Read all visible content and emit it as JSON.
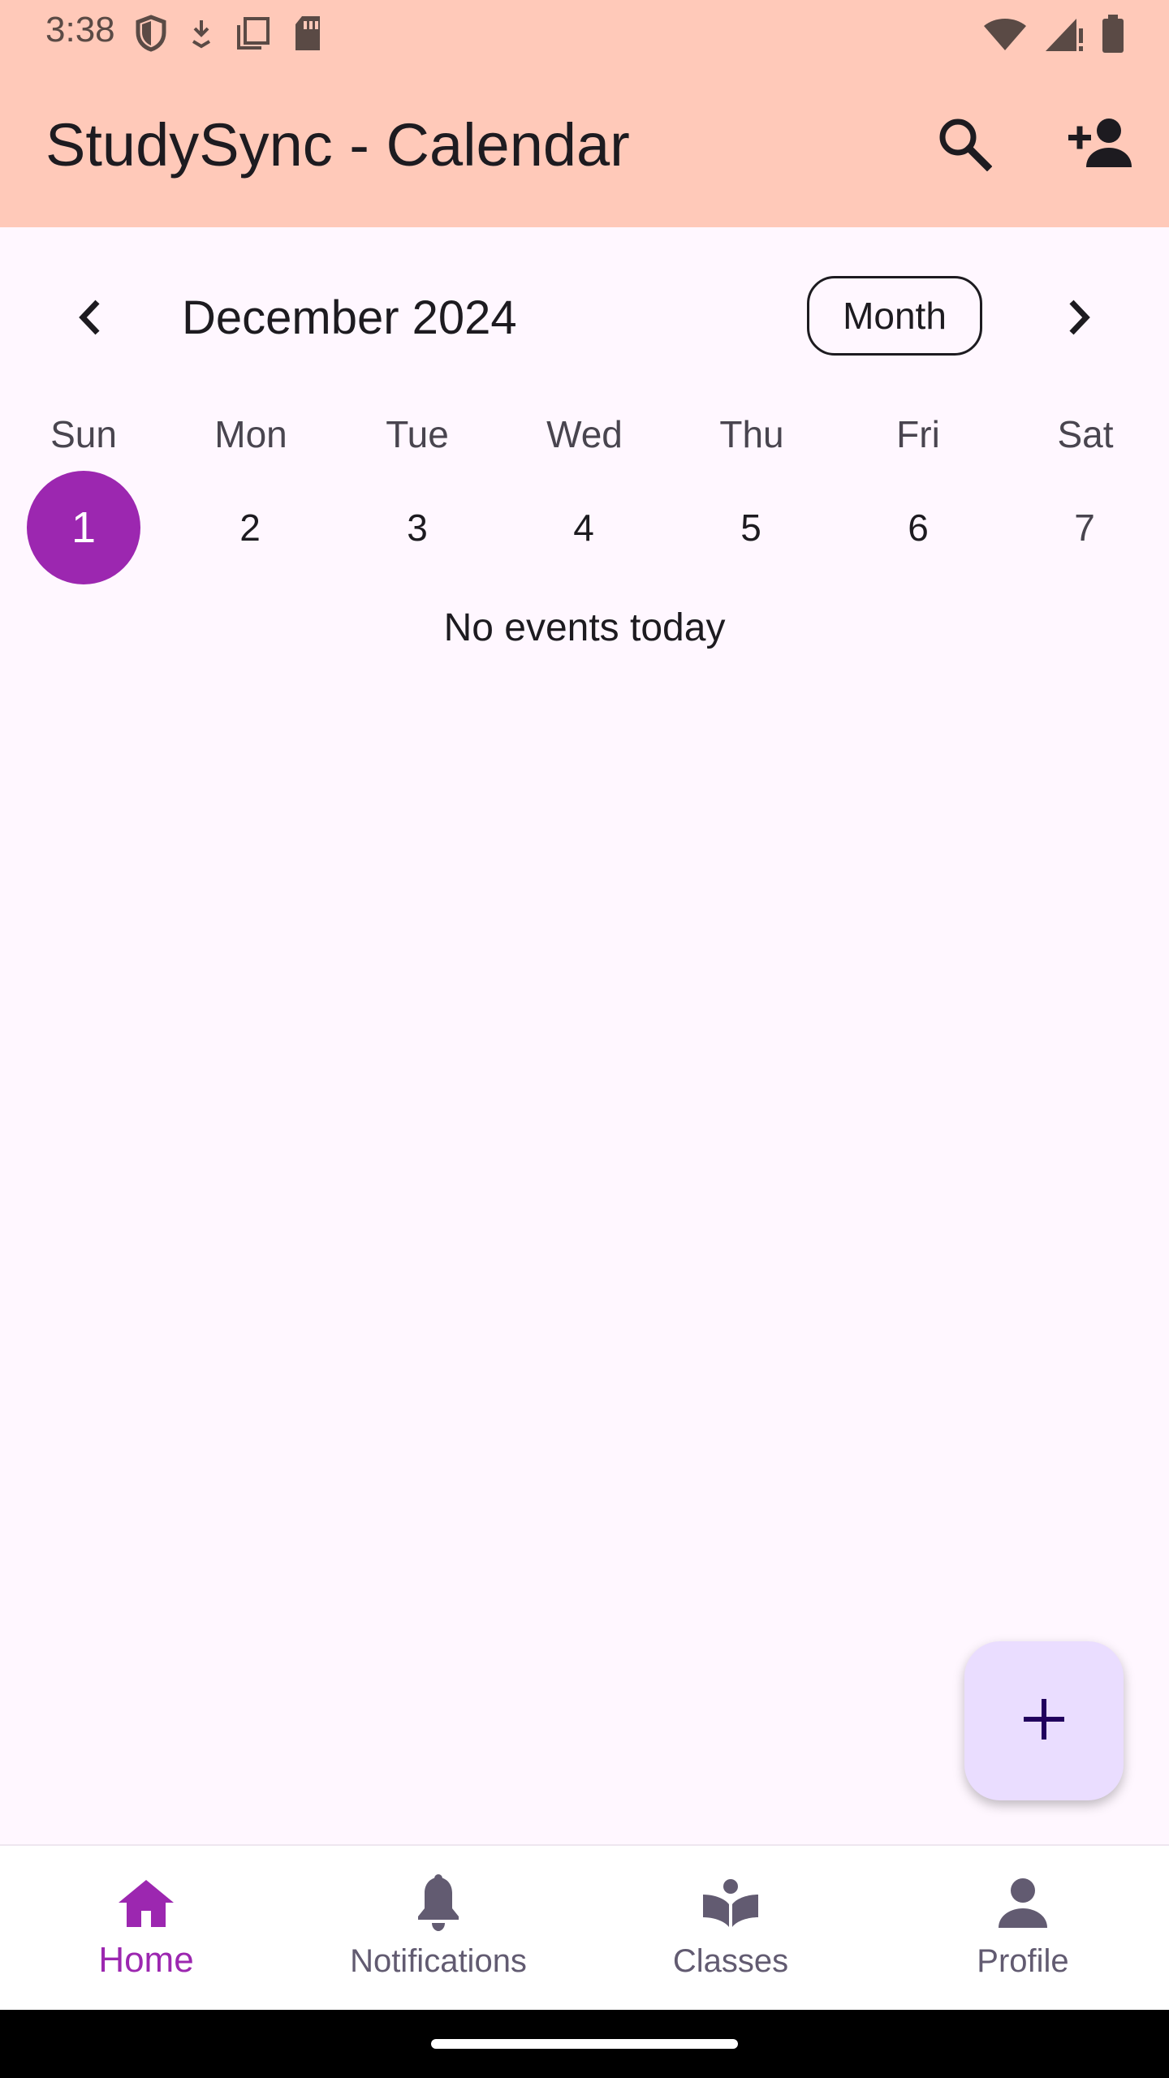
{
  "status_bar": {
    "time": "3:38"
  },
  "app_bar": {
    "title": "StudySync - Calendar",
    "search_icon": "search-icon",
    "add_person_icon": "person-add-icon"
  },
  "calendar": {
    "month_label": "December 2024",
    "view_toggle_label": "Month",
    "weekdays": [
      "Sun",
      "Mon",
      "Tue",
      "Wed",
      "Thu",
      "Fri",
      "Sat"
    ],
    "dates": [
      "1",
      "2",
      "3",
      "4",
      "5",
      "6",
      "7"
    ],
    "selected_date": "1",
    "empty_message": "No events today",
    "accent_color": "#9C27B0"
  },
  "fab": {
    "icon": "plus-icon"
  },
  "bottom_nav": {
    "items": [
      {
        "label": "Home",
        "icon": "home-icon",
        "active": true
      },
      {
        "label": "Notifications",
        "icon": "bell-icon",
        "active": false
      },
      {
        "label": "Classes",
        "icon": "book-icon",
        "active": false
      },
      {
        "label": "Profile",
        "icon": "person-icon",
        "active": false
      }
    ]
  }
}
